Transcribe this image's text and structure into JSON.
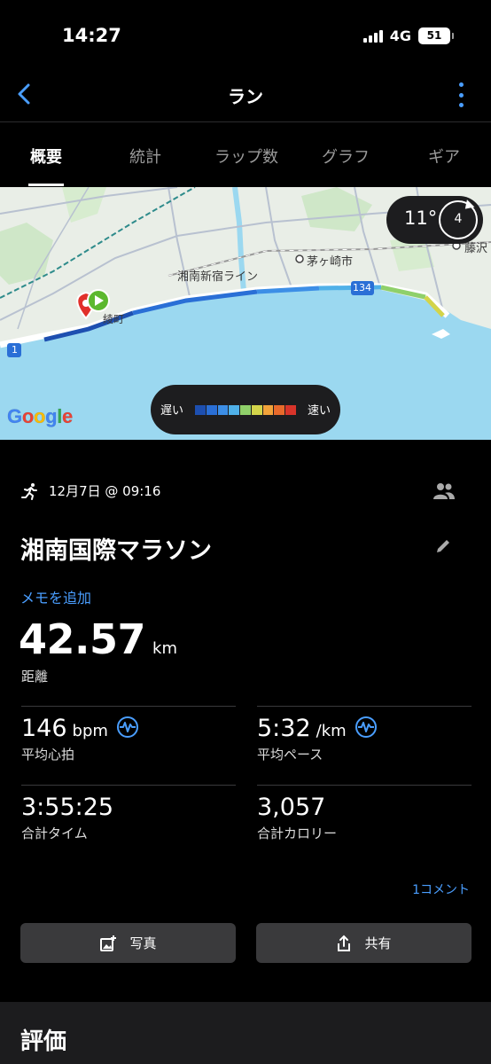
{
  "status": {
    "time": "14:27",
    "network": "4G",
    "battery": "51"
  },
  "nav": {
    "title": "ラン",
    "back_icon": "chevron-left-icon",
    "menu_icon": "vertical-dots-icon",
    "accent": "#4a9eff"
  },
  "tabs": [
    {
      "label": "概要",
      "active": true
    },
    {
      "label": "統計",
      "active": false
    },
    {
      "label": "ラップ数",
      "active": false
    },
    {
      "label": "グラフ",
      "active": false
    },
    {
      "label": "ギア",
      "active": false
    }
  ],
  "map": {
    "labels": {
      "line": "湘南新宿ライン",
      "city1": "茅ヶ崎市",
      "city2": "藤沢",
      "route134": "134",
      "route1": "1",
      "town": "綾町"
    },
    "weather": {
      "temp": "11°",
      "wind": "4"
    },
    "logo": "Google",
    "legend": {
      "slow": "遅い",
      "fast": "速い",
      "colors": [
        "#1d4fb0",
        "#2a6fd6",
        "#3c8ee6",
        "#4fb0e8",
        "#8fd06a",
        "#d3d44a",
        "#f2a33a",
        "#e86a2b",
        "#d8342a"
      ]
    }
  },
  "activity": {
    "date": "12月7日 @ 09:16",
    "name": "湘南国際マラソン",
    "memo_link": "メモを追加",
    "distance": {
      "value": "42.57",
      "unit": "km",
      "label": "距離"
    },
    "stats": {
      "heart_rate": {
        "value": "146",
        "unit": "bpm",
        "label": "平均心拍"
      },
      "pace": {
        "value": "5:32",
        "unit": "/km",
        "label": "平均ペース"
      },
      "time": {
        "value": "3:55:25",
        "label": "合計タイム"
      },
      "calories": {
        "value": "3,057",
        "label": "合計カロリー"
      }
    },
    "comment_link": "1コメント",
    "buttons": {
      "photo": "写真",
      "share": "共有"
    },
    "rating_title": "評価"
  }
}
